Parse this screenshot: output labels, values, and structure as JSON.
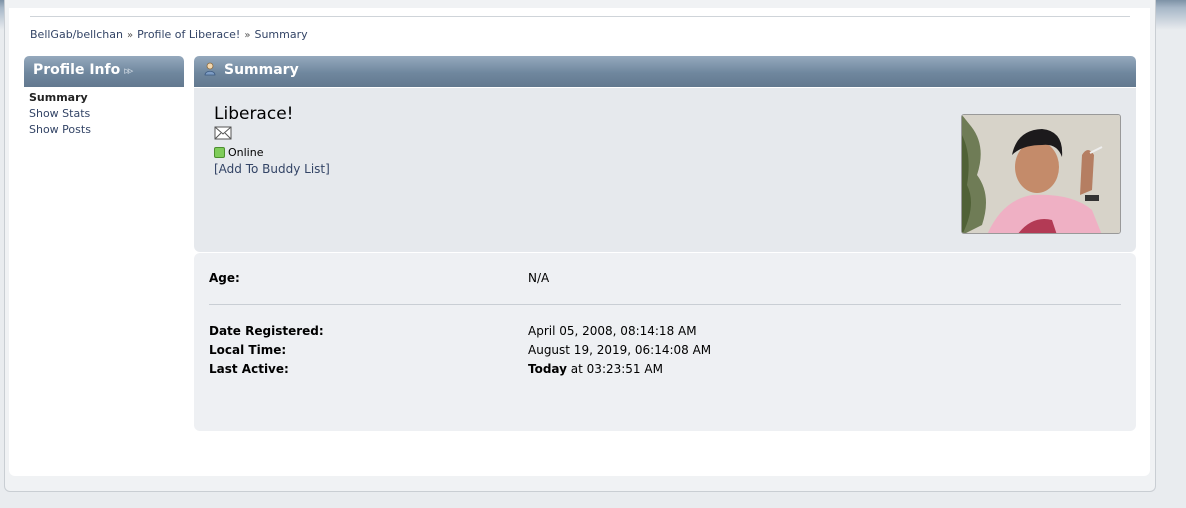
{
  "breadcrumb": {
    "items": [
      "BellGab/bellchan",
      "Profile of Liberace!",
      "Summary"
    ],
    "separator": "»"
  },
  "sidebar": {
    "title": "Profile Info",
    "items": [
      {
        "label": "Summary",
        "active": true
      },
      {
        "label": "Show Stats",
        "active": false
      },
      {
        "label": "Show Posts",
        "active": false
      }
    ]
  },
  "main": {
    "title": "Summary",
    "username": "Liberace!",
    "status": "Online",
    "buddy_link": "[Add To Buddy List]",
    "details": {
      "age_label": "Age:",
      "age_value": "N/A",
      "registered_label": "Date Registered:",
      "registered_value": "April 05, 2008, 08:14:18 AM",
      "local_time_label": "Local Time:",
      "local_time_value": "August 19, 2019, 06:14:08 AM",
      "last_active_label": "Last Active:",
      "last_active_day": "Today",
      "last_active_time": " at 03:23:51 AM"
    }
  },
  "colors": {
    "header_bg": "#6f879e",
    "link": "#334466",
    "online": "#7fcc5a"
  }
}
